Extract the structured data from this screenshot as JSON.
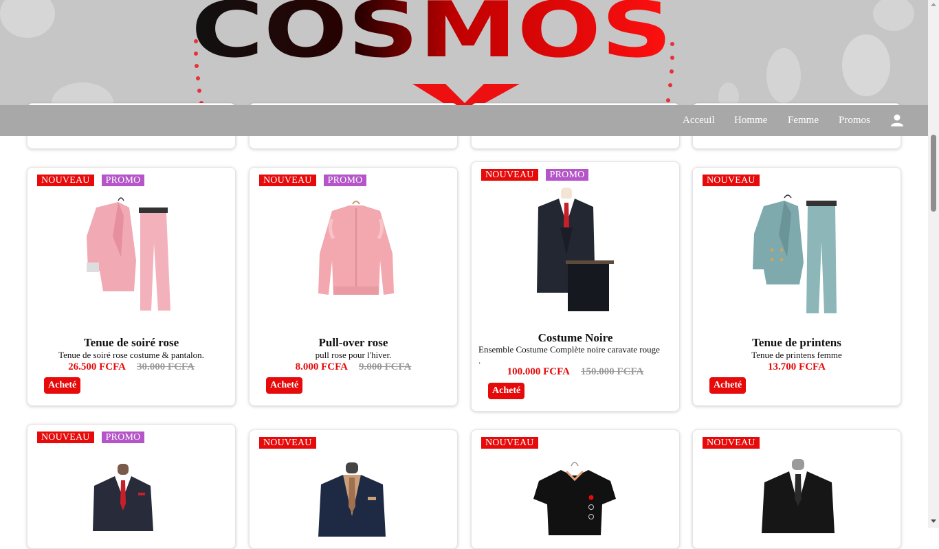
{
  "banner": {
    "logo_text": "COSMOS"
  },
  "nav": {
    "items": [
      "Acceuil",
      "Homme",
      "Femme",
      "Promos"
    ]
  },
  "badges": {
    "new": "NOUVEAU",
    "promo": "PROMO"
  },
  "buy_label": "Acheté",
  "products": [
    {
      "title": "Tenue de soiré rose",
      "description": "Tenue de soiré rose costume & pantalon.",
      "price": "26.500 FCFA",
      "old_price": "30.000 FCFA",
      "image": "pink-suit"
    },
    {
      "title": "Pull-over rose",
      "description": "pull rose pour l'hiver.",
      "price": "8.000 FCFA",
      "old_price": "9.000 FCFA",
      "image": "pink-jacket"
    },
    {
      "title": "Costume Noire",
      "description": "Ensemble Costume Complète noire caravate rouge .",
      "price": "100.000 FCFA",
      "old_price": "150.000 FCFA",
      "image": "black-suit"
    },
    {
      "title": "Tenue de printens",
      "description": "Tenue de printens femme",
      "price": "13.700 FCFA",
      "old_price": "",
      "image": "teal-suit"
    }
  ],
  "colors": {
    "accent": "#e60a0a",
    "promo": "#b455c8",
    "nav": "#a8a8a8"
  }
}
